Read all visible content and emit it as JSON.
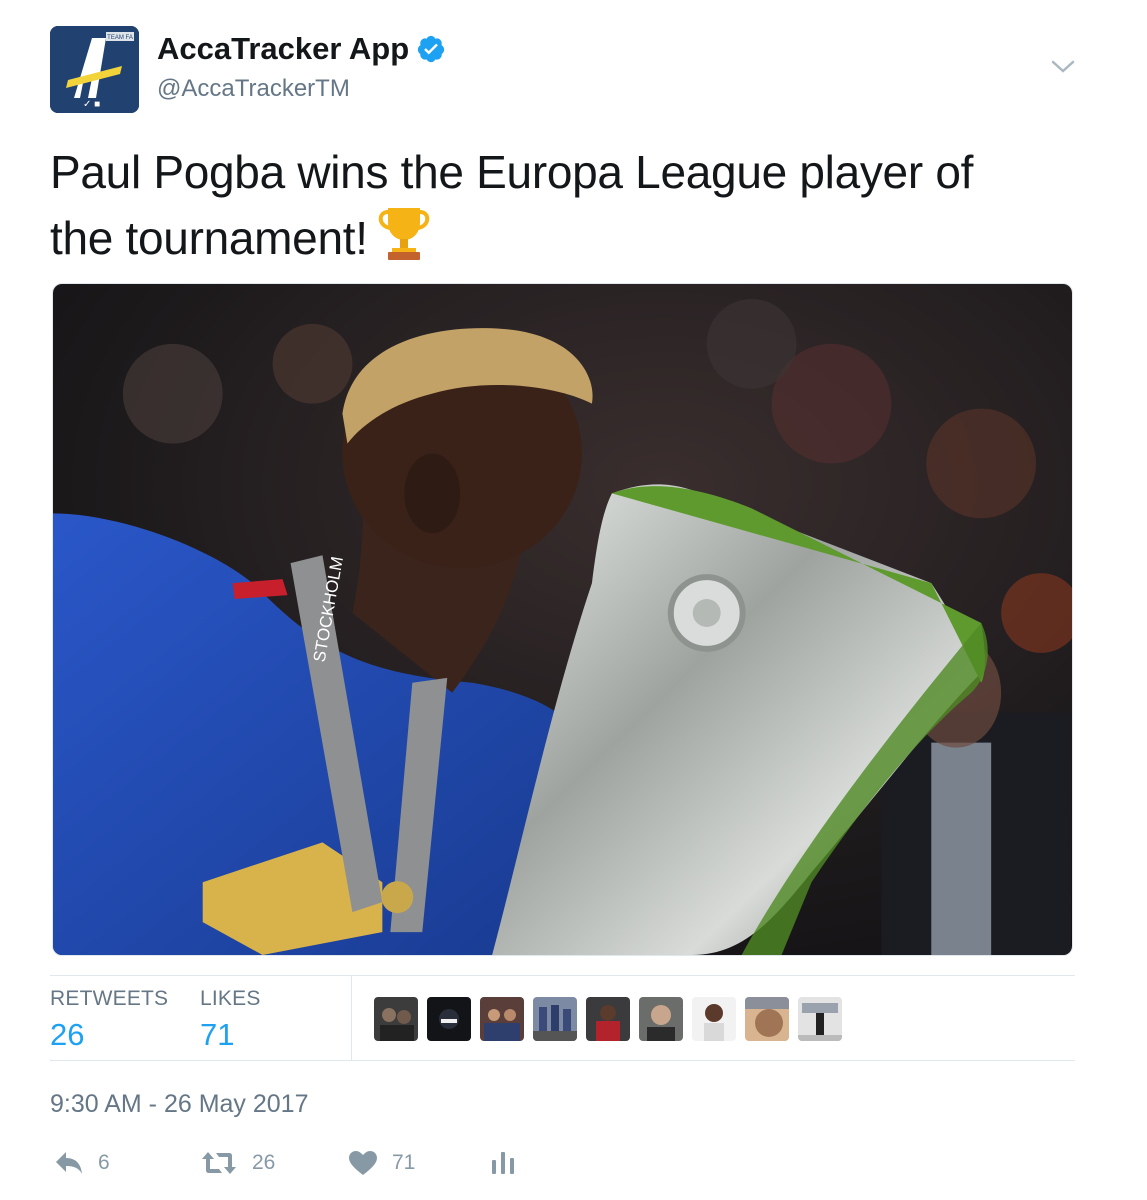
{
  "account": {
    "name": "AccaTracker App",
    "handle": "@AccaTrackerTM",
    "avatar_icon": "accatracker-logo",
    "verified_icon": "verified-badge-icon",
    "avatar_badge_text": "TEAM FA"
  },
  "tweet": {
    "text_line1": "Paul Pogba wins the Europa League player of",
    "text_line2": "the tournament!",
    "emoji": "trophy-icon",
    "media_description_icon": "photo",
    "timestamp": "9:30 AM - 26 May 2017"
  },
  "stats": {
    "retweets_label": "RETWEETS",
    "retweets_value": "26",
    "likes_label": "LIKES",
    "likes_value": "71",
    "liker_avatars_count": 9
  },
  "actions": {
    "reply_count": "6",
    "retweet_count": "26",
    "like_count": "71"
  },
  "colors": {
    "accent": "#1da1f2",
    "muted": "#657786",
    "action_gray": "#8899a6",
    "verified": "#1da1f2",
    "avatar_bg": "#1f3f6c"
  }
}
